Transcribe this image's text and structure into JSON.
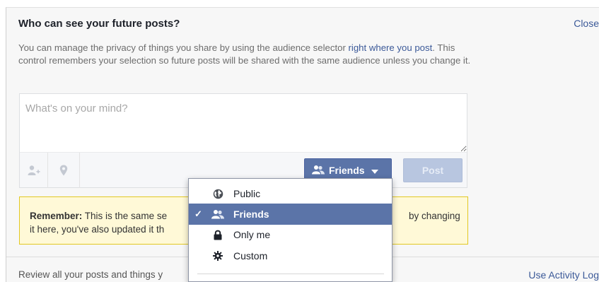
{
  "dialog": {
    "title": "Who can see your future posts?",
    "close_label": "Close",
    "description": {
      "part1": "You can manage the privacy of things you share by using the audience selector ",
      "link": "right where you post",
      "part2": ". This control remembers your selection so future posts will be shared with the same audience unless you change it."
    }
  },
  "composer": {
    "placeholder": "What's on your mind?",
    "tag_icon": "person-add-icon",
    "location_icon": "location-pin-icon",
    "audience_button": "Friends",
    "post_button": "Post"
  },
  "remember": {
    "label": "Remember:",
    "text_visible": " This is the same se",
    "text_tail": "by changing",
    "line2": "it here, you've also updated it th"
  },
  "footer": {
    "text": "Review all your posts and things y",
    "activity_log_label": "Use Activity Log"
  },
  "audience_menu": {
    "items": [
      {
        "label": "Public",
        "icon": "globe-icon",
        "selected": false
      },
      {
        "label": "Friends",
        "icon": "friends-icon",
        "selected": true
      },
      {
        "label": "Only me",
        "icon": "lock-icon",
        "selected": false
      },
      {
        "label": "Custom",
        "icon": "gear-icon",
        "selected": false
      }
    ],
    "check_mark": "✓"
  },
  "colors": {
    "accent": "#5b74a8",
    "link": "#3b5998",
    "notice_bg": "#fff9d7",
    "notice_border": "#e2c822"
  }
}
